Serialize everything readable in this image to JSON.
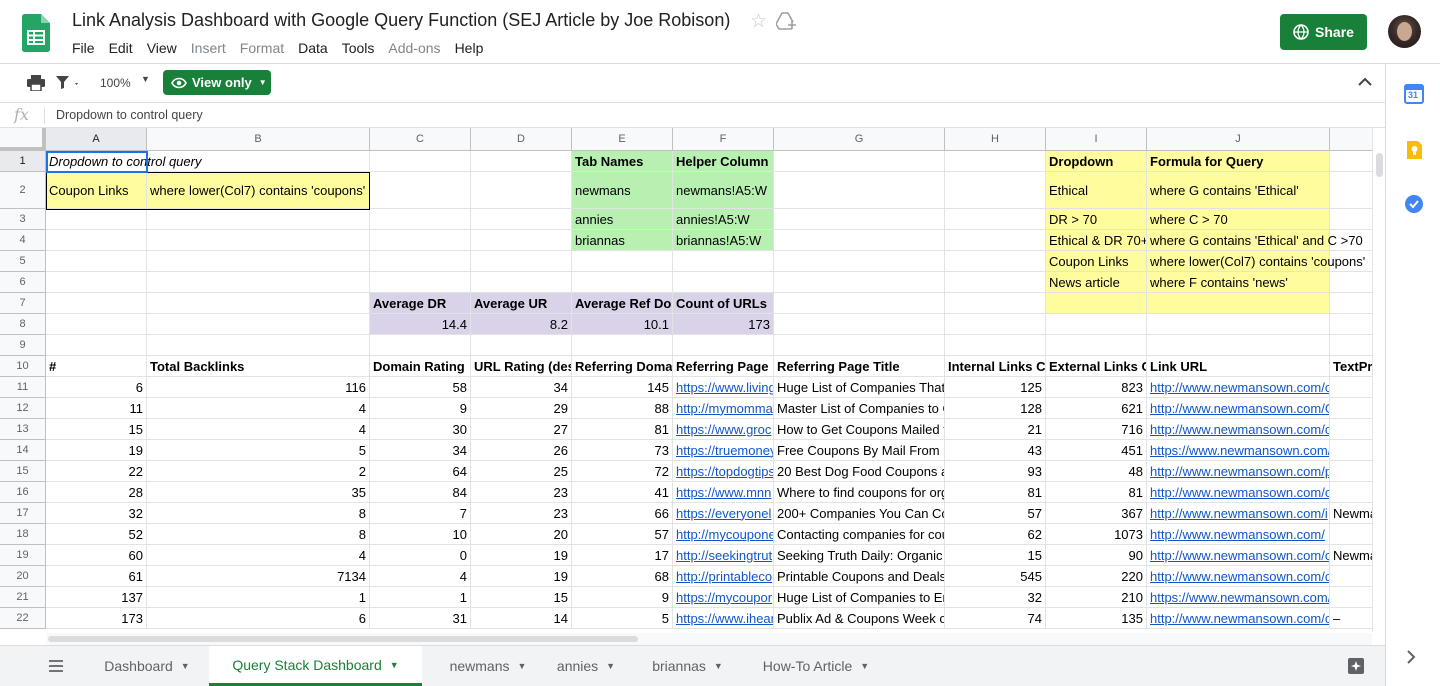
{
  "app": {
    "title": "Link Analysis Dashboard with Google Query Function (SEJ Article by Joe Robison)",
    "menus": [
      {
        "label": "File",
        "disabled": false
      },
      {
        "label": "Edit",
        "disabled": false
      },
      {
        "label": "View",
        "disabled": false
      },
      {
        "label": "Insert",
        "disabled": true
      },
      {
        "label": "Format",
        "disabled": true
      },
      {
        "label": "Data",
        "disabled": false
      },
      {
        "label": "Tools",
        "disabled": false
      },
      {
        "label": "Add-ons",
        "disabled": true
      },
      {
        "label": "Help",
        "disabled": false
      }
    ],
    "share_label": "Share"
  },
  "toolbar": {
    "zoom": "100%",
    "view_only_label": "View only"
  },
  "formula_bar": {
    "fx": "fx",
    "value": "Dropdown to control query"
  },
  "columns": [
    {
      "id": "A",
      "selected": true
    },
    {
      "id": "B"
    },
    {
      "id": "C"
    },
    {
      "id": "D"
    },
    {
      "id": "E"
    },
    {
      "id": "F"
    },
    {
      "id": "G"
    },
    {
      "id": "H"
    },
    {
      "id": "I"
    },
    {
      "id": "J"
    },
    {
      "id": ""
    }
  ],
  "rows": [
    "1",
    "2",
    "3",
    "4",
    "5",
    "6",
    "7",
    "8",
    "9",
    "10",
    "11",
    "12",
    "13",
    "14",
    "15",
    "16",
    "17",
    "18",
    "19",
    "20",
    "21",
    "22"
  ],
  "cells": [
    {
      "r": 0,
      "c": 0,
      "t": "Dropdown to control query",
      "s": "ov",
      "italic": true
    },
    {
      "r": 1,
      "c": 0,
      "t": "Coupon Links",
      "bg": "y",
      "wrap": true
    },
    {
      "r": 1,
      "c": 1,
      "t": "where lower(Col7) contains 'coupons'",
      "bg": "y"
    },
    {
      "r": 0,
      "c": 4,
      "t": "Tab Names",
      "bg": "g",
      "s": "b"
    },
    {
      "r": 0,
      "c": 5,
      "t": "Helper Column",
      "bg": "g",
      "s": "b"
    },
    {
      "r": 1,
      "c": 4,
      "t": "newmans",
      "bg": "g"
    },
    {
      "r": 1,
      "c": 5,
      "t": "newmans!A5:W",
      "bg": "g"
    },
    {
      "r": 2,
      "c": 4,
      "t": "annies",
      "bg": "g"
    },
    {
      "r": 2,
      "c": 5,
      "t": "annies!A5:W",
      "bg": "g"
    },
    {
      "r": 3,
      "c": 4,
      "t": "briannas",
      "bg": "g"
    },
    {
      "r": 3,
      "c": 5,
      "t": "briannas!A5:W",
      "bg": "g"
    },
    {
      "r": 0,
      "c": 8,
      "t": "Dropdown",
      "bg": "y",
      "s": "b"
    },
    {
      "r": 0,
      "c": 9,
      "t": "Formula for Query",
      "bg": "y",
      "s": "b"
    },
    {
      "r": 1,
      "c": 8,
      "t": "Ethical",
      "bg": "y"
    },
    {
      "r": 1,
      "c": 9,
      "t": "where G contains 'Ethical'",
      "bg": "y"
    },
    {
      "r": 2,
      "c": 8,
      "t": "DR > 70",
      "bg": "y"
    },
    {
      "r": 2,
      "c": 9,
      "t": "where C > 70",
      "bg": "y"
    },
    {
      "r": 3,
      "c": 8,
      "t": "Ethical & DR 70+",
      "bg": "y"
    },
    {
      "r": 3,
      "c": 9,
      "t": "where G contains 'Ethical' and C >70",
      "bg": "y",
      "s": "ov"
    },
    {
      "r": 4,
      "c": 8,
      "t": "Coupon Links",
      "bg": "y"
    },
    {
      "r": 4,
      "c": 9,
      "t": "where lower(Col7) contains 'coupons'",
      "bg": "y",
      "s": "ov"
    },
    {
      "r": 5,
      "c": 8,
      "t": "News article",
      "bg": "y"
    },
    {
      "r": 5,
      "c": 9,
      "t": "where F contains 'news'",
      "bg": "y"
    },
    {
      "r": 6,
      "c": 8,
      "t": "",
      "bg": "y"
    },
    {
      "r": 6,
      "c": 9,
      "t": "",
      "bg": "y"
    },
    {
      "r": 6,
      "c": 2,
      "t": "Average DR",
      "bg": "p",
      "s": "b"
    },
    {
      "r": 6,
      "c": 3,
      "t": "Average UR",
      "bg": "p",
      "s": "b"
    },
    {
      "r": 6,
      "c": 4,
      "t": "Average Ref Do",
      "bg": "p",
      "s": "b"
    },
    {
      "r": 6,
      "c": 5,
      "t": "Count of URLs",
      "bg": "p",
      "s": "b"
    },
    {
      "r": 7,
      "c": 2,
      "t": "14.4",
      "bg": "p",
      "s": "num"
    },
    {
      "r": 7,
      "c": 3,
      "t": "8.2",
      "bg": "p",
      "s": "num"
    },
    {
      "r": 7,
      "c": 4,
      "t": "10.1",
      "bg": "p",
      "s": "num"
    },
    {
      "r": 7,
      "c": 5,
      "t": "173",
      "bg": "p",
      "s": "num"
    }
  ],
  "table_headers": [
    "#",
    "Total Backlinks",
    "Domain Rating",
    "URL Rating (des",
    "Referring Doma",
    "Referring Page",
    "Referring Page Title",
    "Internal Links C",
    "External Links C",
    "Link URL",
    "TextPr"
  ],
  "table_rows": [
    [
      "6",
      "116",
      "58",
      "34",
      "145",
      "https://www.living",
      "Huge List of Companies That",
      "125",
      "823",
      "http://www.newmansown.com/contact-",
      ""
    ],
    [
      "11",
      "4",
      "9",
      "29",
      "88",
      "http://mymomma",
      "Master List of Companies to G",
      "128",
      "621",
      "http://www.newmansown.com/General",
      ""
    ],
    [
      "15",
      "4",
      "30",
      "27",
      "81",
      "https://www.groc",
      "How to Get Coupons Mailed t",
      "21",
      "716",
      "http://www.newmansown.com/contact",
      ""
    ],
    [
      "19",
      "5",
      "34",
      "26",
      "73",
      "https://truemoney",
      "Free Coupons By Mail From 1",
      "43",
      "451",
      "https://www.newmansown.com/contact",
      ""
    ],
    [
      "22",
      "2",
      "64",
      "25",
      "72",
      "https://topdogtips",
      "20 Best Dog Food Coupons a",
      "93",
      "48",
      "http://www.newmansown.com/pet",
      ""
    ],
    [
      "28",
      "35",
      "84",
      "23",
      "41",
      "https://www.mnn",
      "Where to find coupons for org",
      "81",
      "81",
      "http://www.newmansown.com/coupons",
      ""
    ],
    [
      "32",
      "8",
      "7",
      "23",
      "66",
      "https://everyonel",
      "200+ Companies You Can Co",
      "57",
      "367",
      "http://www.newmansown.com/i",
      "Newma"
    ],
    [
      "52",
      "8",
      "10",
      "20",
      "57",
      "http://mycoupone",
      "Contacting companies for cou",
      "62",
      "1073",
      "http://www.newmansown.com/",
      ""
    ],
    [
      "60",
      "4",
      "0",
      "19",
      "17",
      "http://seekingtrut",
      "Seeking Truth Daily: Organic",
      "15",
      "90",
      "http://www.newmansown.com/c",
      "Newma"
    ],
    [
      "61",
      "7134",
      "4",
      "19",
      "68",
      "http://printableco",
      "Printable Coupons and Deals",
      "545",
      "220",
      "http://www.newmansown.com/coupons",
      ""
    ],
    [
      "137",
      "1",
      "1",
      "15",
      "9",
      "https://mycoupor",
      "Huge List of Companies to Er",
      "32",
      "210",
      "https://www.newmansown.com/contact",
      ""
    ],
    [
      "173",
      "6",
      "31",
      "14",
      "5",
      "https://www.ihear",
      "Publix Ad & Coupons Week o",
      "74",
      "135",
      "http://www.newmansown.com/c",
      "–"
    ]
  ],
  "sheet_tabs": [
    {
      "label": "Dashboard",
      "active": false
    },
    {
      "label": "Query Stack Dashboard",
      "active": true
    },
    {
      "label": "newmans",
      "active": false
    },
    {
      "label": "annies",
      "active": false
    },
    {
      "label": "briannas",
      "active": false
    },
    {
      "label": "How-To Article",
      "active": false
    }
  ],
  "colors": {
    "accent": "#188038",
    "green_fill": "#b7f0b1",
    "yellow_fill": "#fffc9e",
    "purple_fill": "#d9d2e9",
    "link": "#1155cc"
  },
  "side_icons": [
    "calendar-icon",
    "keep-icon",
    "tasks-icon"
  ],
  "calendar_day": "31"
}
